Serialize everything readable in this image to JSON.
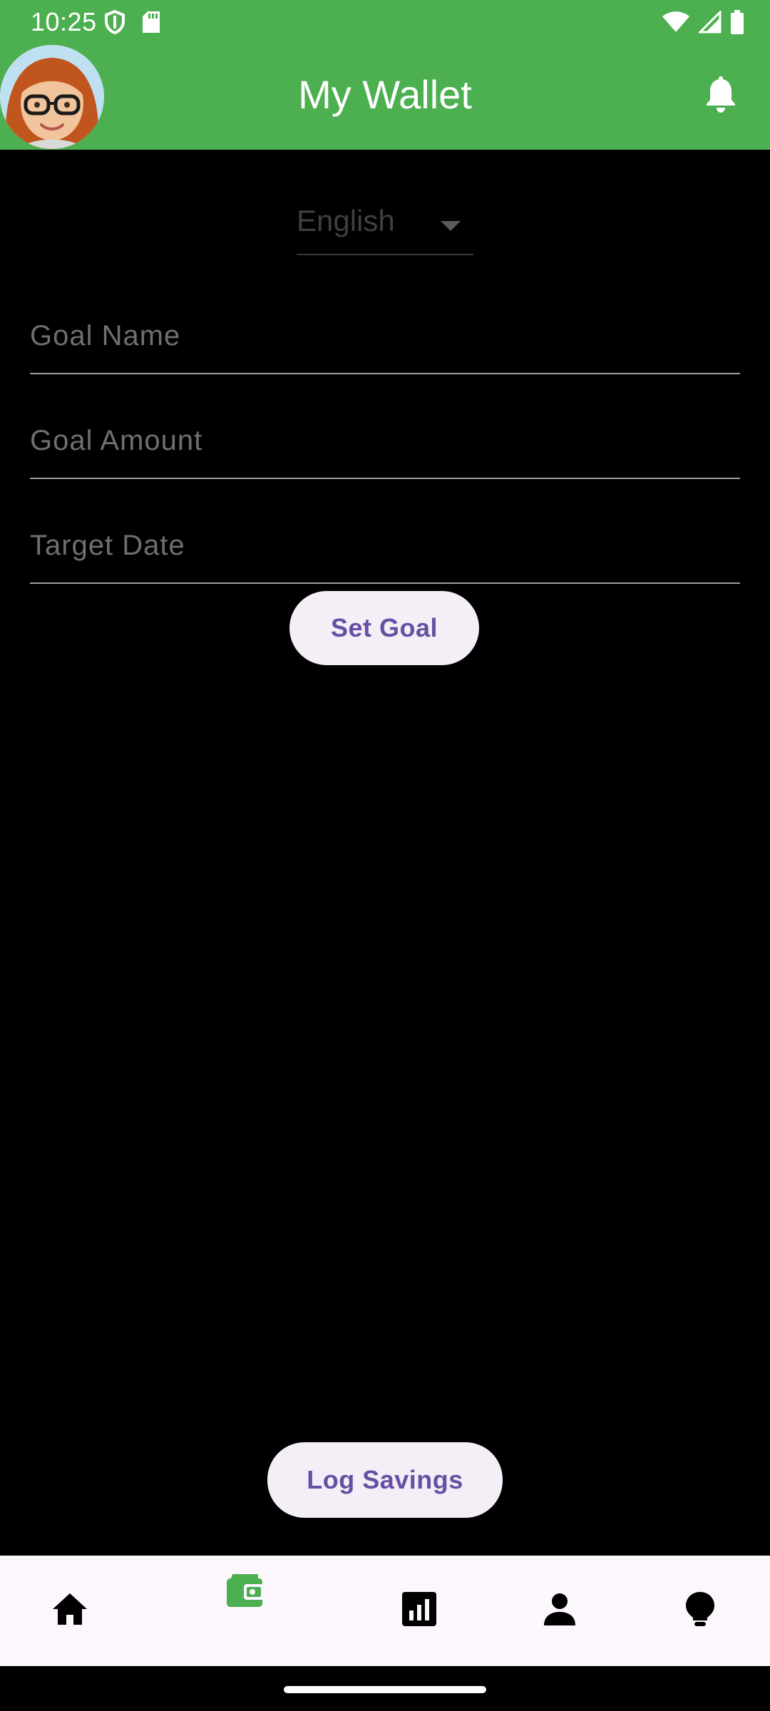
{
  "status_bar": {
    "time": "10:25",
    "left_icons": [
      "shield-icon",
      "sd-card-icon"
    ],
    "right_icons": [
      "wifi-icon",
      "signal-icon",
      "battery-icon"
    ]
  },
  "app_bar": {
    "title": "My Wallet",
    "avatar_icon": "avatar",
    "action_icon": "bell-icon",
    "background_color": "#4CAF50"
  },
  "language_selector": {
    "selected": "English"
  },
  "form": {
    "goal_name_placeholder": "Goal Name",
    "goal_amount_placeholder": "Goal Amount",
    "target_date_placeholder": "Target Date",
    "goal_name_value": "",
    "goal_amount_value": "",
    "target_date_value": "",
    "set_goal_label": "Set Goal"
  },
  "log_savings_label": "Log Savings",
  "bottom_nav": {
    "items": [
      {
        "icon": "home-icon",
        "active": false
      },
      {
        "icon": "wallet-icon",
        "active": true
      },
      {
        "icon": "bar-chart-icon",
        "active": false
      },
      {
        "icon": "person-icon",
        "active": false
      },
      {
        "icon": "lightbulb-icon",
        "active": false
      }
    ],
    "active_color": "#4CAF50"
  },
  "colors": {
    "button_bg": "#F4EEF7",
    "button_text": "#6750A4",
    "background": "#000000"
  }
}
